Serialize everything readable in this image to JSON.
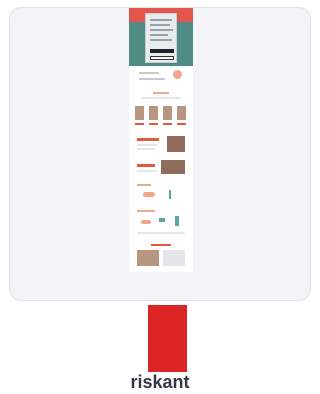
{
  "preview": {
    "label": "riskant",
    "risk_color": "#dc2626"
  }
}
